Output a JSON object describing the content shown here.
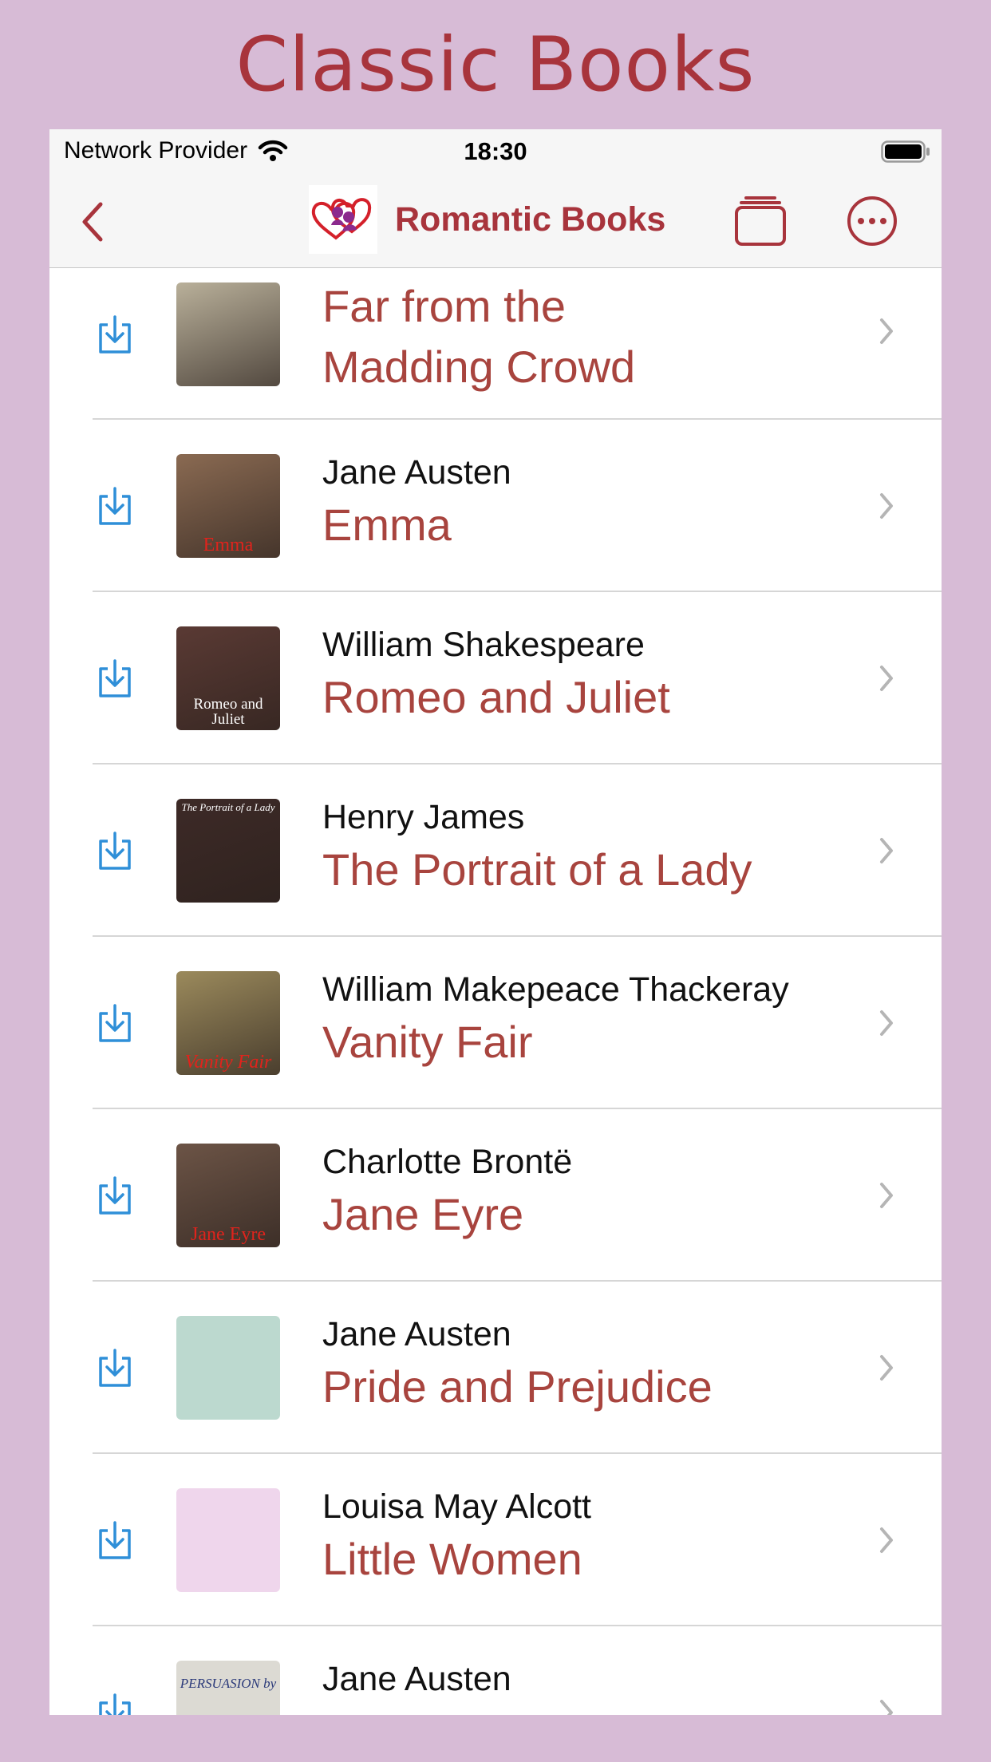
{
  "banner": {
    "title": "Classic Books"
  },
  "status": {
    "provider": "Network Provider",
    "time": "18:30"
  },
  "nav": {
    "title": "Romantic Books",
    "back_icon": "chevron-left-icon",
    "tabs_icon": "stacked-pages-icon",
    "more_icon": "ellipsis-circle-icon"
  },
  "colors": {
    "accent": "#a8343c",
    "title_text": "#a8443e",
    "download_blue": "#2f8fd8",
    "background": "#d7bbd6"
  },
  "books": [
    {
      "author": "",
      "title_lines": [
        "Far from the",
        "Madding Crowd"
      ],
      "cover_caption": "",
      "cover_bg": "#b9b09a",
      "caption_color": "#000"
    },
    {
      "author": "Jane Austen",
      "title_lines": [
        "Emma"
      ],
      "cover_caption": "Emma",
      "cover_bg": "#8a6a52",
      "caption_color": "#e0231c"
    },
    {
      "author": "William Shakespeare",
      "title_lines": [
        "Romeo and Juliet"
      ],
      "cover_caption": "Romeo and Juliet",
      "cover_bg": "#5a3a34",
      "caption_color": "#ffffff"
    },
    {
      "author": "Henry James",
      "title_lines": [
        "The Portrait of a Lady"
      ],
      "cover_caption": "The Portrait of a Lady",
      "cover_bg": "#3d2a27",
      "caption_color": "#ffffff"
    },
    {
      "author": "William Makepeace Thackeray",
      "title_lines": [
        "Vanity Fair"
      ],
      "cover_caption": "Vanity Fair",
      "cover_bg": "#9b8a5c",
      "caption_color": "#e0231c"
    },
    {
      "author": "Charlotte Brontë",
      "title_lines": [
        "Jane Eyre"
      ],
      "cover_caption": "Jane Eyre",
      "cover_bg": "#6c5446",
      "caption_color": "#e0231c"
    },
    {
      "author": "Jane Austen",
      "title_lines": [
        "Pride and Prejudice"
      ],
      "cover_caption": "",
      "cover_bg": "#bcd9cf",
      "caption_color": "#000"
    },
    {
      "author": "Louisa May Alcott",
      "title_lines": [
        "Little Women"
      ],
      "cover_caption": "",
      "cover_bg": "#efd6ec",
      "caption_color": "#000"
    },
    {
      "author": "Jane Austen",
      "title_lines": [
        ""
      ],
      "cover_caption": "PERSUASION by",
      "cover_bg": "#dcdad3",
      "caption_color": "#2b3a7a"
    }
  ]
}
